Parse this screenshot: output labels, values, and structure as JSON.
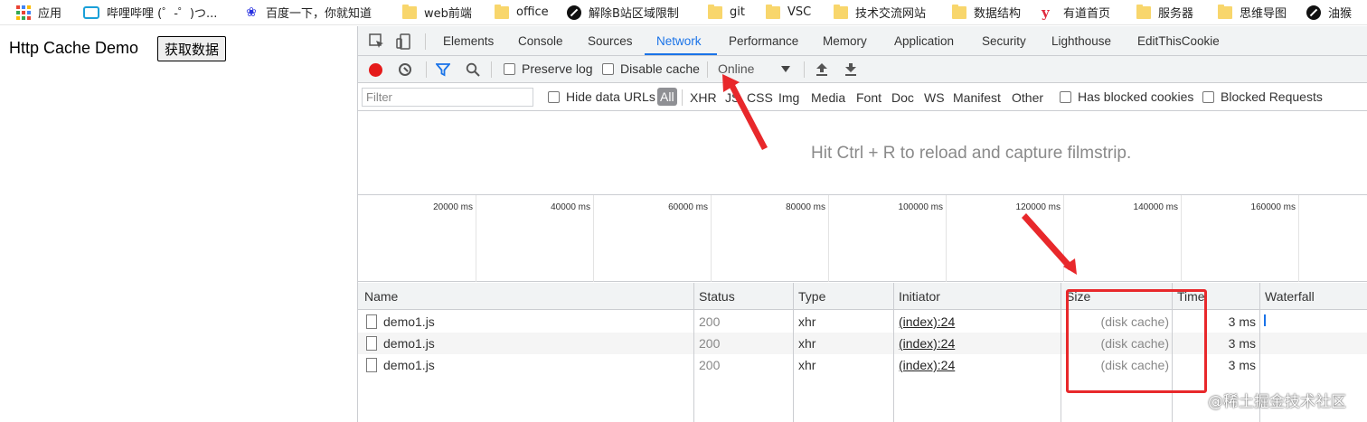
{
  "bookmarks": [
    "应用",
    "哔哩哔哩 (゜-゜)つ...",
    "百度一下，你就知道",
    "web前端",
    "office",
    "解除B站区域限制",
    "git",
    "VSC",
    "技术交流网站",
    "数据结构",
    "有道首页",
    "服务器",
    "思维导图",
    "油猴"
  ],
  "page": {
    "title": "Http Cache Demo",
    "button_label": "获取数据"
  },
  "devtools": {
    "tabs": [
      "Elements",
      "Console",
      "Sources",
      "Network",
      "Performance",
      "Memory",
      "Application",
      "Security",
      "Lighthouse",
      "EditThisCookie"
    ],
    "active_tab": "Network",
    "toolbar": {
      "preserve_log": "Preserve log",
      "disable_cache": "Disable cache",
      "throttle": "Online"
    },
    "filter": {
      "placeholder": "Filter",
      "hide_data_urls": "Hide data URLs",
      "types": [
        "All",
        "XHR",
        "JS",
        "CSS",
        "Img",
        "Media",
        "Font",
        "Doc",
        "WS",
        "Manifest",
        "Other"
      ],
      "has_blocked_cookies": "Has blocked cookies",
      "blocked_requests": "Blocked Requests"
    },
    "filmstrip_message": "Hit Ctrl + R to reload and capture filmstrip.",
    "timeline_ticks": [
      "20000 ms",
      "40000 ms",
      "60000 ms",
      "80000 ms",
      "100000 ms",
      "120000 ms",
      "140000 ms",
      "160000 ms"
    ],
    "columns": [
      "Name",
      "Status",
      "Type",
      "Initiator",
      "Size",
      "Time",
      "Waterfall"
    ],
    "rows": [
      {
        "name": "demo1.js",
        "status": "200",
        "type": "xhr",
        "initiator": "(index):24",
        "size": "(disk cache)",
        "time": "3 ms"
      },
      {
        "name": "demo1.js",
        "status": "200",
        "type": "xhr",
        "initiator": "(index):24",
        "size": "(disk cache)",
        "time": "3 ms"
      },
      {
        "name": "demo1.js",
        "status": "200",
        "type": "xhr",
        "initiator": "(index):24",
        "size": "(disk cache)",
        "time": "3 ms"
      }
    ]
  },
  "watermark": "@稀土掘金技术社区",
  "colors": {
    "accent": "#1a73e8",
    "record": "#e51b1b",
    "annotation": "#e8282b"
  }
}
